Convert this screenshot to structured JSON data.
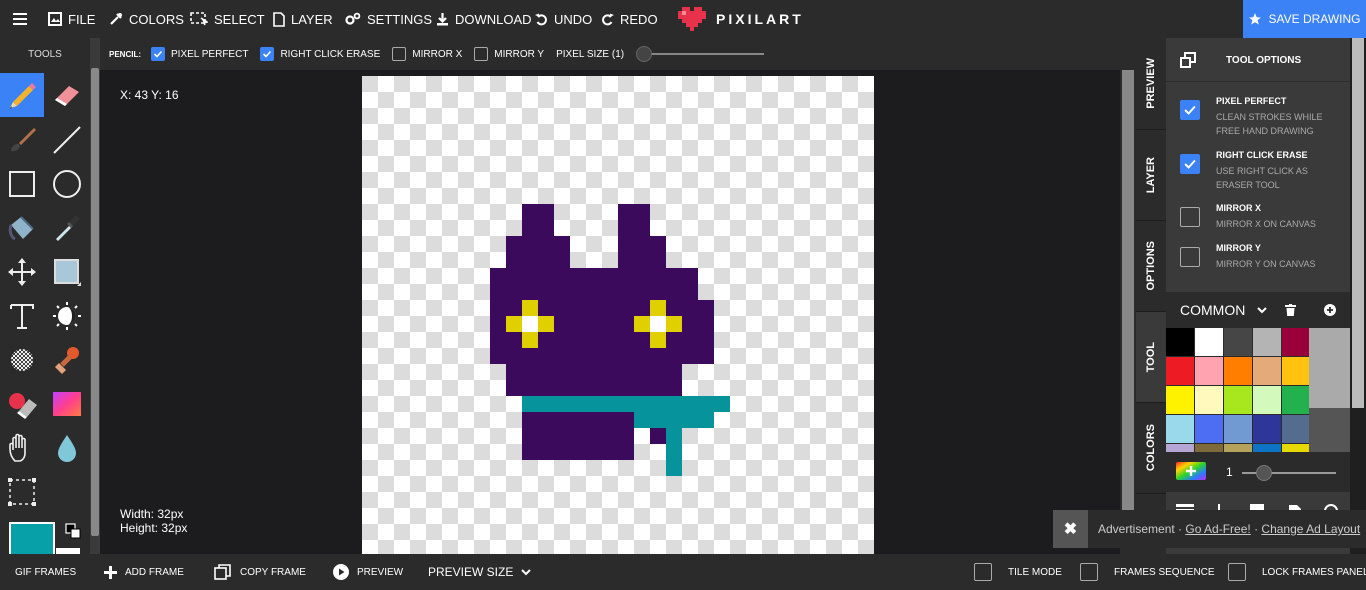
{
  "menu": {
    "file": "FILE",
    "colors": "COLORS",
    "select": "SELECT",
    "layer": "LAYER",
    "settings": "SETTINGS",
    "download": "DOWNLOAD",
    "undo": "UNDO",
    "redo": "REDO",
    "brand": "PIXILART",
    "save": "SAVE DRAWING"
  },
  "tools": {
    "heading": "TOOLS",
    "active": "pencil",
    "items": [
      "pencil",
      "eraser",
      "brush",
      "line",
      "rectangle",
      "ellipse",
      "fill-bucket",
      "eyedropper",
      "move",
      "shape-fill",
      "text",
      "lighten-darken",
      "dither",
      "stamp",
      "color-replace",
      "gradient",
      "hand",
      "blur",
      "selection"
    ],
    "primary_color": "#07a0a8"
  },
  "options_bar": {
    "tool_label": "PENCIL:",
    "pixel_perfect": "PIXEL PERFECT",
    "pixel_perfect_checked": true,
    "right_click_erase": "RIGHT CLICK ERASE",
    "right_click_erase_checked": true,
    "mirror_x": "MIRROR X",
    "mirror_x_checked": false,
    "mirror_y": "MIRROR Y",
    "mirror_y_checked": false,
    "pixel_size_label": "PIXEL SIZE (1)",
    "pixel_size": 1
  },
  "canvas": {
    "coords": "X: 43 Y: 16",
    "width_text": "Width: 32px",
    "height_text": "Height: 32px",
    "palette": {
      "1": "#3b0a5c",
      "2": "#e0d000",
      "3": "#ffffff",
      "4": "#07939c"
    },
    "rows": [
      "................................",
      "................................",
      "................................",
      "................................",
      "................................",
      "................................",
      "................................",
      "................................",
      "..........11....11..............",
      "..........11....11..............",
      ".........1111...111.............",
      ".........1111...111.............",
      "........1111111111111...........",
      "........1111111111111...........",
      "........11211111112111..........",
      "........12321111123211..........",
      "........11211111112111..........",
      "........11111111111111..........",
      ".........11111111111............",
      ".........11111111111............",
      "..........4444444444444.........",
      "..........111111144444..........",
      "..........1111111.14............",
      "..........1111111..4............",
      "...................4............",
      "................................",
      "................................",
      "................................",
      "................................",
      "................................",
      "................................",
      "................................"
    ]
  },
  "side_tabs": {
    "preview": "PREVIEW",
    "layer": "LAYER",
    "options": "OPTIONS",
    "tool": "TOOL",
    "colors": "COLORS",
    "active": "tool"
  },
  "tool_options": {
    "title": "TOOL OPTIONS",
    "items": [
      {
        "label": "PIXEL PERFECT",
        "desc": "CLEAN STROKES WHILE FREE HAND DRAWING",
        "checked": true
      },
      {
        "label": "RIGHT CLICK ERASE",
        "desc": "USE RIGHT CLICK AS ERASER TOOL",
        "checked": true
      },
      {
        "label": "MIRROR X",
        "desc": "MIRROR X ON CANVAS",
        "checked": false
      },
      {
        "label": "MIRROR Y",
        "desc": "MIRROR Y ON CANVAS",
        "checked": false
      }
    ]
  },
  "palette": {
    "name": "COMMON",
    "colors": [
      "#000000",
      "#ffffff",
      "#464646",
      "#b4b4b4",
      "#99003a",
      "#9c5a3c",
      "#ed1c24",
      "#ffa3b1",
      "#ff7e00",
      "#e5aa7a",
      "#ffc20e",
      "#f5e49c",
      "#fff200",
      "#fff9bd",
      "#a8e61d",
      "#d3f9bc",
      "#22b14c",
      "#00b7ef",
      "#99d9ea",
      "#4d6df3",
      "#709ad1",
      "#2f3699",
      "#546d8e",
      "#6f3198",
      "#b5a5d5",
      "#7f6a3b",
      "#b5a35b",
      "#0d74c5",
      "#e7d800",
      "#c8a400"
    ],
    "brush_size": "1"
  },
  "ad": {
    "close": "✖",
    "text": "Advertisement · ",
    "link1": "Go Ad-Free!",
    "sep": " · ",
    "link2": "Change Ad Layout"
  },
  "bottom": {
    "gif_frames": "GIF FRAMES",
    "add_frame": "ADD FRAME",
    "copy_frame": "COPY FRAME",
    "preview": "PREVIEW",
    "preview_size": "PREVIEW SIZE",
    "tile_mode": "TILE MODE",
    "frames_sequence": "FRAMES SEQUENCE",
    "lock_frames": "LOCK FRAMES PANEL"
  }
}
